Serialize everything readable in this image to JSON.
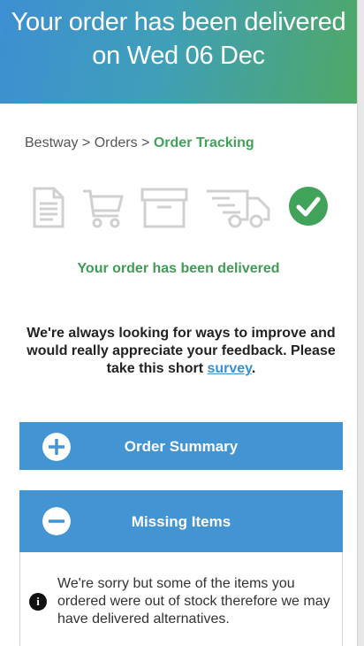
{
  "header": {
    "line1": "Your order has been delivered",
    "line2": "on Wed 06 Dec"
  },
  "breadcrumb": {
    "item1": "Bestway",
    "sep": " > ",
    "item2": "Orders",
    "current": "Order Tracking"
  },
  "steps": [
    {
      "icon": "document-icon",
      "state": "done"
    },
    {
      "icon": "cart-icon",
      "state": "done"
    },
    {
      "icon": "box-icon",
      "state": "done"
    },
    {
      "icon": "truck-icon",
      "state": "done"
    },
    {
      "icon": "check-circle-icon",
      "state": "current"
    }
  ],
  "status_message": "Your order has been delivered",
  "feedback": {
    "text_before": "We're always looking for ways to improve and would really appreciate your feedback. Please take this short ",
    "link": "survey",
    "text_after": "."
  },
  "accordions": {
    "order_summary": {
      "label": "Order Summary",
      "state": "collapsed"
    },
    "missing_items": {
      "label": "Missing Items",
      "state": "expanded"
    }
  },
  "missing_items_message": "We're sorry but some of the items you ordered were out of stock therefore we may have delivered alternatives.",
  "colors": {
    "accent_blue": "#4394d2",
    "success_green": "#41a35a",
    "icon_grey": "#d0d0d0"
  }
}
